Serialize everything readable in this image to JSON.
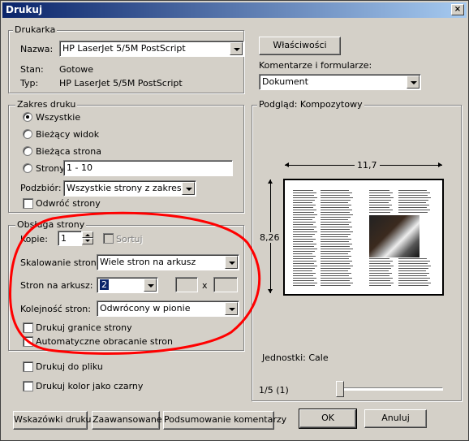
{
  "window": {
    "title": "Drukuj",
    "close_label": "×"
  },
  "printer": {
    "group_title": "Drukarka",
    "name_label": "Nazwa:",
    "name_value": "HP LaserJet 5/5M PostScript",
    "status_label": "Stan:",
    "status_value": "Gotowe",
    "type_label": "Typ:",
    "type_value": "HP LaserJet 5/5M PostScript",
    "properties_button": "Właściwości",
    "comments_label": "Komentarze i formularze:",
    "comments_value": "Dokument"
  },
  "range": {
    "group_title": "Zakres druku",
    "all": "Wszystkie",
    "current_view": "Bieżący widok",
    "current_page": "Bieżąca strona",
    "pages": "Strony",
    "pages_value": "1 - 10",
    "subset_label": "Podzbiór:",
    "subset_value": "Wszystkie strony z zakresu",
    "reverse": "Odwróć strony"
  },
  "handling": {
    "group_title": "Obsługa strony",
    "copies_label": "Kopie:",
    "copies_value": "1",
    "collate": "Sortuj",
    "scaling_label": "Skalowanie strony:",
    "scaling_value": "Wiele stron na arkusz",
    "pages_per_sheet_label": "Stron na arkusz:",
    "pages_per_sheet_value": "2",
    "x_label": "x",
    "order_label": "Kolejność stron:",
    "order_value": "Odwrócony w pionie",
    "print_borders": "Drukuj granice strony",
    "auto_rotate": "Automatyczne obracanie stron"
  },
  "output": {
    "print_to_file": "Drukuj do pliku",
    "print_color_black": "Drukuj kolor jako czarny"
  },
  "preview": {
    "title": "Podgląd: Kompozytowy",
    "width": "11,7",
    "height": "8,26",
    "units": "Jednostki: Cale",
    "page_indicator": "1/5 (1)",
    "slider_position": 0.0
  },
  "buttons": {
    "tips": "Wskazówki druku",
    "advanced": "Zaawansowane",
    "summary": "Podsumowanie komentarzy",
    "ok": "OK",
    "cancel": "Anuluj"
  },
  "colors": {
    "titlebar": "#0a246a",
    "annotation": "#ff0000",
    "face": "#d4d0c8"
  }
}
